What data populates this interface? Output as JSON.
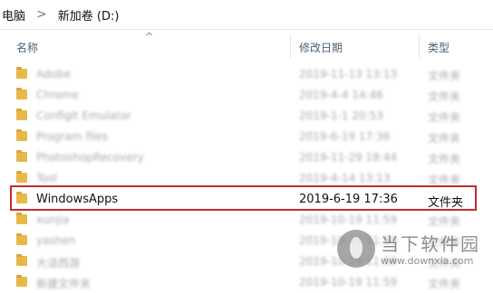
{
  "breadcrumb": {
    "segments": [
      "电脑",
      "新加卷 (D:)"
    ],
    "separator": ">"
  },
  "columns": {
    "name": "名称",
    "modified": "修改日期",
    "type": "类型"
  },
  "files": [
    {
      "name": "Adobe",
      "date": "2019-11-13 13:13",
      "type": "文件夹"
    },
    {
      "name": "Chrome",
      "date": "2019-4-4 14:46",
      "type": "文件夹"
    },
    {
      "name": "ConfigIt Emulator",
      "date": "2019-1-1 20:53",
      "type": "文件夹"
    },
    {
      "name": "Program files",
      "date": "2019-6-19 17:36",
      "type": "文件夹"
    },
    {
      "name": "PhotoshopRecovery",
      "date": "2019-11-29 18:44",
      "type": "文件夹"
    },
    {
      "name": "Tool",
      "date": "2019-4-14 13:13",
      "type": "文件夹"
    },
    {
      "name": "WindowsApps",
      "date": "2019-6-19 17:36",
      "type": "文件夹"
    },
    {
      "name": "xunjia",
      "date": "2019-10-19 11:59",
      "type": "文件夹"
    },
    {
      "name": "yashen",
      "date": "2019-10-19 11:59",
      "type": "文件夹"
    },
    {
      "name": "大话西游",
      "date": "2019-10-19 11:59",
      "type": "文件夹"
    },
    {
      "name": "新建文件夹",
      "date": "2019-10-19 11:59",
      "type": "文件夹"
    }
  ],
  "watermark": {
    "text": "当下软件园",
    "url": "www.downxia.com"
  },
  "colors": {
    "highlight": "#c42b2b",
    "folder": "#e8b84a"
  }
}
